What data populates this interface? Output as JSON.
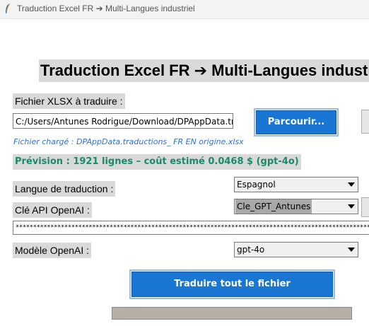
{
  "window": {
    "title": "Traduction Excel FR ➔ Multi-Langues industriel"
  },
  "main": {
    "heading": "Traduction Excel FR ➔ Multi-Langues industriel",
    "file_label": "Fichier XLSX à traduire :",
    "file_path": "C:/Users/Antunes Rodrigue/Download/DPAppData.traductions_ FR EN origine.xlsx",
    "browse_label": "Parcourir...",
    "loaded_file": "Fichier chargé : DPAppData.traductions_ FR EN origine.xlsx",
    "forecast": "Prévision : 1921 lignes – coût estimé 0.0468 $ (gpt-4o)",
    "language_label": "Langue de traduction :",
    "language_value": "Espagnol",
    "api_key_label": "Clé API OpenAI :",
    "api_key_value": "Cle_GPT_Antunes",
    "api_key_masked": "************************************************************************************************************************",
    "model_label": "Modèle OpenAI :",
    "model_value": "gpt-4o",
    "translate_label": "Traduire tout le fichier",
    "progress": 0
  },
  "colors": {
    "accent": "#1976d2",
    "forecast_text": "#1a8a6b",
    "loaded_text": "#2e6fd0",
    "label_bg": "#d9d9d9"
  }
}
